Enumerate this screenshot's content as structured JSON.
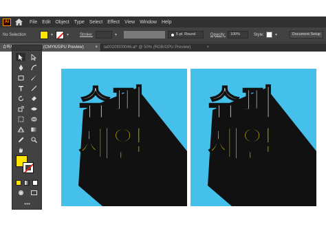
{
  "menu": {
    "app_logo": "Ai",
    "items": [
      "File",
      "Edit",
      "Object",
      "Type",
      "Select",
      "Effect",
      "View",
      "Window",
      "Help"
    ]
  },
  "control_bar": {
    "selection_label": "No Selection",
    "stroke_label": "Stroke:",
    "brush_label": "5 pt. Round",
    "opacity_label": "Opacity:",
    "opacity_value": "100%",
    "style_label": "Style:",
    "doc_setup_label": "Document Setup"
  },
  "tabs": [
    {
      "label": "슈퍼세일 1.ai* @ 50% (CMYK/GPU Preview)",
      "close": "×"
    },
    {
      "label": "ta0020f000046.ai* @ 50% (RGB/GPU Preview)",
      "close": "×"
    }
  ],
  "artboards": [
    {
      "line1": "슈퍼",
      "line2": "세일"
    },
    {
      "line1": "슈퍼",
      "line2": "세일"
    }
  ],
  "colors": {
    "artboard_bg": "#44c0ea",
    "line1_text": "#ffffff",
    "line2_text": "#ffe600",
    "shadow": "#111111",
    "fill_color": "#ffe600",
    "stroke_none": "#e02020"
  },
  "tools": [
    "selection-tool-icon",
    "direct-selection-tool-icon",
    "pen-tool-icon",
    "curvature-tool-icon",
    "rectangle-tool-icon",
    "paintbrush-tool-icon",
    "type-tool-icon",
    "line-tool-icon",
    "rotate-tool-icon",
    "eraser-tool-icon",
    "scale-tool-icon",
    "width-tool-icon",
    "free-transform-tool-icon",
    "shape-builder-tool-icon",
    "perspective-grid-tool-icon",
    "mesh-tool-icon",
    "gradient-tool-icon",
    "eyedropper-tool-icon",
    "artboard-tool-icon",
    "hand-tool-icon",
    "zoom-tool-icon",
    "draw-mode-icon",
    "screen-mode-icon",
    "more-tools-icon"
  ]
}
